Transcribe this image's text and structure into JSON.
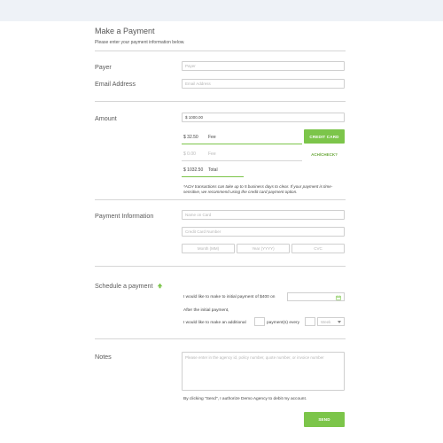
{
  "header": {
    "title": "Make a Payment",
    "subtitle": "Please enter your payment information below."
  },
  "payer": {
    "label": "Payer",
    "placeholder": "Payer"
  },
  "email": {
    "label": "Email Address",
    "placeholder": "Email Address"
  },
  "amount": {
    "label": "Amount",
    "value": "$ 1000.00",
    "fee_card_amount": "$ 32.50",
    "fee_card_label": "Fee",
    "fee_ach_amount": "$ 0.00",
    "fee_ach_label": "Fee",
    "total_amount": "$ 1032.50",
    "total_label": "Total",
    "credit_card_button": "CREDIT CARD",
    "ach_button": "ACH/CHECK?",
    "ach_note": "*ACH transactions can take up to 5 business days to clear.  If your payment is time-sensitive, we recommend using the credit card payment option."
  },
  "payment_info": {
    "label": "Payment Information",
    "name_placeholder": "Name on Card",
    "card_placeholder": "Credit Card Number",
    "month_placeholder": "Month (MM)",
    "year_placeholder": "Year (YYYY)",
    "cvc_placeholder": "CVC"
  },
  "schedule": {
    "label": "Schedule a payment",
    "initial_text": "I would like to make to initial payment of $400 on",
    "after_text": "After the initial payment,",
    "additional_prefix": "I would like to make an additional",
    "additional_mid": "payment(s)  every",
    "frequency_value": "Week"
  },
  "notes": {
    "label": "Notes",
    "placeholder": "Please enter in the agency id, policy number, quote number, or invoice number"
  },
  "authorize_text": "By clicking \"Send\", I authorize Demo Agency to debit my account.",
  "send_button": "SEND",
  "colors": {
    "accent": "#7cc54a",
    "background": "#ffffff",
    "topbar": "#eef2f7"
  }
}
